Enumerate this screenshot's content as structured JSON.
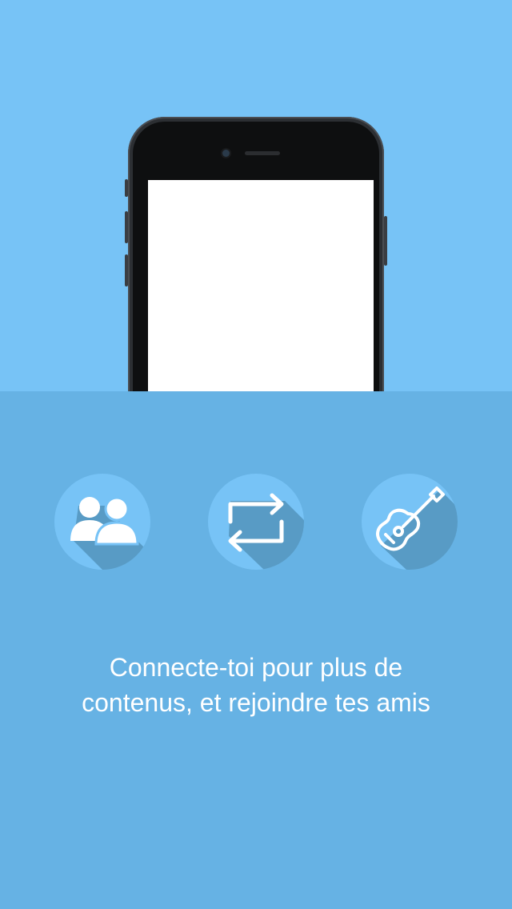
{
  "colors": {
    "top_background": "#77c3f6",
    "bottom_background": "#66b2e4",
    "icon_circle": "#77c3f6",
    "icon_shadow": "#4d8eb4",
    "text": "#ffffff"
  },
  "illustration": {
    "device": "smartphone",
    "screen": "blank"
  },
  "features": [
    {
      "icon": "friends-icon"
    },
    {
      "icon": "repeat-icon"
    },
    {
      "icon": "guitar-icon"
    }
  ],
  "onboarding": {
    "message_line1": "Connecte-toi pour plus de",
    "message_line2": "contenus, et rejoindre tes amis"
  }
}
